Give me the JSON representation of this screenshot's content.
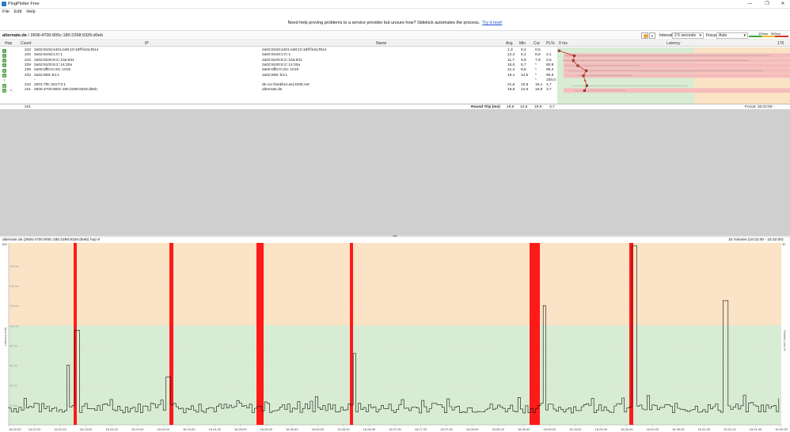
{
  "window": {
    "title": "PingPlotter Free",
    "minimize": "—",
    "maximize": "❐",
    "close": "✕"
  },
  "menu": [
    "File",
    "Edit",
    "Help"
  ],
  "banner": {
    "text": "Need help proving problems to a service provider but unsure how? Sidekick automates the process.",
    "link": "Try it now!"
  },
  "toolbar": {
    "target_host": "alternate.de",
    "target_ip": "/ 2606:4700:900c:180:2298:9326:d0eb",
    "interval_label": "Interval",
    "interval_value": "2.5 seconds",
    "focus_label": "Focus",
    "focus_value": "Auto",
    "scale_100": "100ms",
    "scale_500": "500ms"
  },
  "table": {
    "headers": {
      "hop": "Hop",
      "count": "Count",
      "ip": "IP",
      "name": "Name",
      "avg": "Avg",
      "min": "Min",
      "cur": "Cur",
      "pl": "PL%",
      "latency_start": "0 ms",
      "latency": "Latency",
      "latency_end": "170 ms"
    },
    "rows": [
      {
        "hop": "1",
        "count": "242",
        "ip": "2a02:810d:4401:ed8:10:18ff:fe2a:f814",
        "name": "2a02:810d:4401:ed8:10:18ff:fe2a:f814",
        "avg": "1,3",
        "min": "0,4",
        "cur": "0,5",
        "pl": "",
        "lat": 1.3,
        "minv": 0.4,
        "maxv": 3,
        "pl_bg": false
      },
      {
        "hop": "2",
        "count": "242",
        "ip": "2a02:810d:1:0::1",
        "name": "2a02:810d:1:0::1",
        "avg": "12,4",
        "min": "5,1",
        "cur": "8,8",
        "pl": "2,1",
        "lat": 12.4,
        "minv": 5.1,
        "maxv": 155,
        "pl_bg": true
      },
      {
        "hop": "3",
        "count": "242",
        "ip": "2a02:8100:6:2::10a:631",
        "name": "2a02:8100:6:2::10a:631",
        "avg": "11,7",
        "min": "3,6",
        "cur": "7,9",
        "pl": "2,5",
        "lat": 11.7,
        "minv": 3.6,
        "maxv": 140,
        "pl_bg": true
      },
      {
        "hop": "4",
        "count": "229",
        "ip": "2a02:8100:6:2::14:20a",
        "name": "2a02:8100:6:2::14:20a",
        "avg": "15,0",
        "min": "5,7",
        "cur": "*",
        "pl": "90,8",
        "lat": 15,
        "minv": 5.7,
        "maxv": 60,
        "pl_bg": true
      },
      {
        "hop": "5",
        "count": "239",
        "ip": "2a00:dff0:0:c01::c019",
        "name": "2a00:dff0:0:c01::c019",
        "avg": "21,2",
        "min": "8,5",
        "cur": "*",
        "pl": "95,4",
        "lat": 21.2,
        "minv": 8.5,
        "maxv": 150,
        "pl_bg": true
      },
      {
        "hop": "6",
        "count": "232",
        "ip": "2a02:908::54:1",
        "name": "2a02:908::54:1",
        "avg": "19,1",
        "min": "14,5",
        "cur": "*",
        "pl": "90,9",
        "lat": 19.1,
        "minv": 14.5,
        "maxv": 55,
        "pl_bg": true
      },
      {
        "hop": "7",
        "count": "",
        "ip": "-",
        "name": "",
        "avg": "",
        "min": "",
        "cur": "*",
        "pl": "100,0",
        "lat": null,
        "minv": null,
        "maxv": null,
        "pl_bg": false
      },
      {
        "hop": "8",
        "count": "242",
        "ip": "2001:7f8::3417:0:1",
        "name": "de-cix-frankfurt.as13335.net",
        "avg": "21,6",
        "min": "10,9",
        "cur": "16,1",
        "pl": "1,7",
        "lat": 21.6,
        "minv": 10.9,
        "maxv": 95,
        "pl_bg": false
      },
      {
        "hop": "9",
        "count": "241",
        "ip": "2606:4700:900c:180:2298:9326:d0eb",
        "name": "alternate.de",
        "avg": "19,9",
        "min": "12,6",
        "cur": "19,9",
        "pl": "3,7",
        "lat": 19.9,
        "minv": 12.6,
        "maxv": 50,
        "pl_bg": true
      }
    ],
    "roundtrip": {
      "count": "241",
      "label": "Round Trip (ms)",
      "avg": "19,9",
      "min": "12,6",
      "cur": "19,9",
      "pl": "3,7",
      "focus": "Focus: 16:22:00 - 16:32:00"
    }
  },
  "colors": {
    "good": "#d8ecd3",
    "warn": "#fbe3c6",
    "bad": "#f5bcbc",
    "loss": "#ff1a1a",
    "trace": "#d9302a"
  },
  "graph": {
    "title": "alternate.de (2606:4700:900c:180:2298:9326:d0eb) hop 9",
    "range": "10 minutes (16:22:00 - 16:32:00)",
    "ylabel": "Latency (ms)",
    "ylabel_right": "Packet Loss %",
    "y_top_left": "183",
    "y_top_right": "30",
    "ytick_labels": [
      "160 ms",
      "140 ms",
      "120 ms",
      "100 ms",
      "80 ms",
      "60 ms",
      "40 ms",
      "20 ms"
    ],
    "xtick_labels": [
      "16:22:00",
      "16:22:20",
      "16:22:40",
      "16:23:00",
      "16:23:20",
      "16:23:40",
      "16:24:00",
      "16:24:20",
      "16:24:40",
      "16:25:00",
      "16:25:20",
      "16:25:40",
      "16:26:00",
      "16:26:20",
      "16:26:40",
      "16:27:00",
      "16:27:20",
      "16:27:40",
      "16:28:00",
      "16:28:20",
      "16:28:40",
      "16:29:00",
      "16:29:20",
      "16:29:40",
      "16:30:00",
      "16:30:20",
      "16:30:40",
      "16:31:00",
      "16:31:20",
      "16:31:40",
      "16:32:00"
    ],
    "ymax": 183,
    "loss_ranges": [
      [
        0.14,
        0.146
      ],
      [
        0.343,
        0.349
      ],
      [
        0.531,
        0.543
      ],
      [
        0.733,
        0.739
      ],
      [
        0.907,
        0.925
      ],
      [
        0.982,
        0.988
      ]
    ]
  }
}
